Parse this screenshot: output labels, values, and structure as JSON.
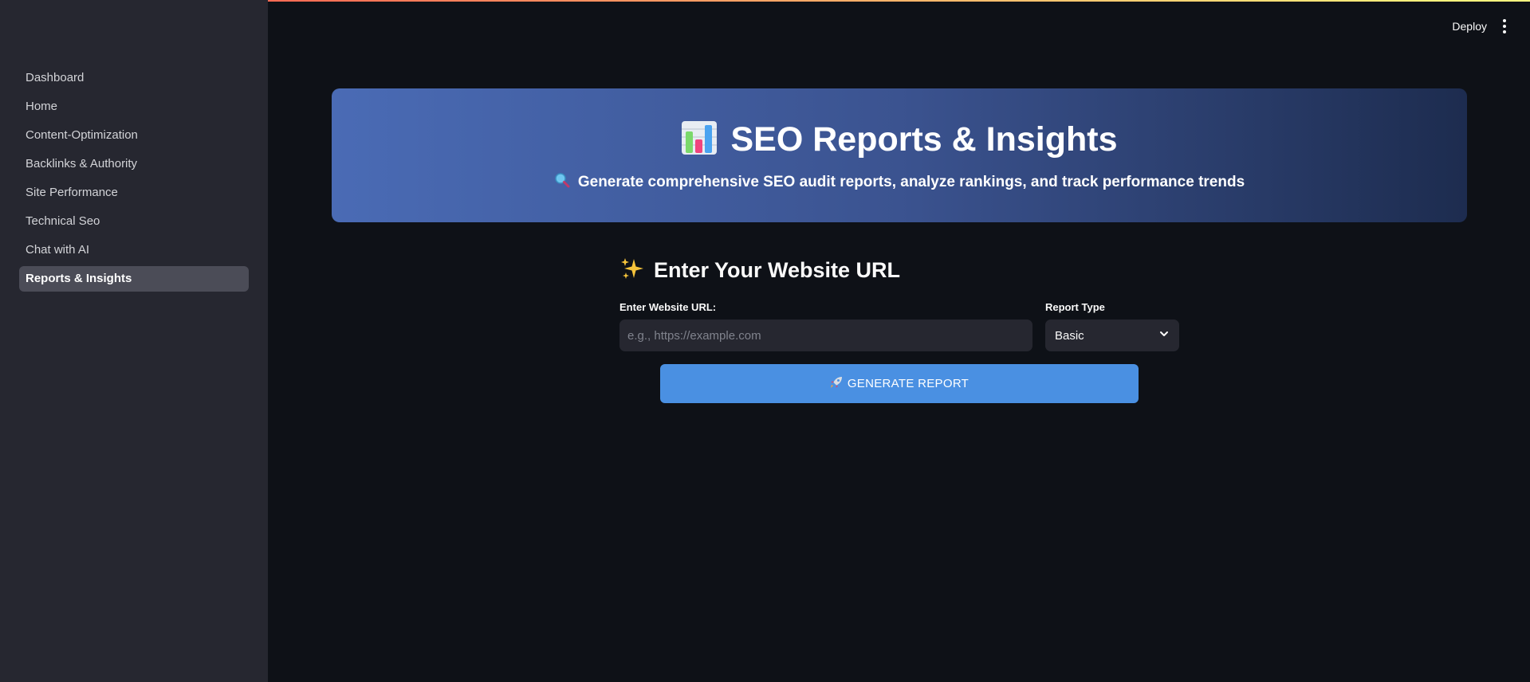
{
  "header": {
    "deploy_label": "Deploy"
  },
  "sidebar": {
    "items": [
      {
        "label": "Dashboard"
      },
      {
        "label": "Home"
      },
      {
        "label": "Content-Optimization"
      },
      {
        "label": "Backlinks & Authority"
      },
      {
        "label": "Site Performance"
      },
      {
        "label": "Technical Seo"
      },
      {
        "label": "Chat with AI"
      },
      {
        "label": "Reports & Insights",
        "active": true
      }
    ]
  },
  "banner": {
    "icon": "bar-chart-icon",
    "title": "SEO Reports & Insights",
    "subtitle_icon": "magnifier-icon",
    "subtitle": "Generate comprehensive SEO audit reports, analyze rankings, and track performance trends",
    "gradient_start": "#4a6bb5",
    "gradient_end": "#1d2c4f"
  },
  "form": {
    "section_icon": "sparkles-icon",
    "section_title": "Enter Your Website URL",
    "url_label": "Enter Website URL:",
    "url_placeholder": "e.g., https://example.com",
    "url_value": "",
    "report_type_label": "Report Type",
    "report_type_value": "Basic",
    "generate_icon": "rocket-icon",
    "generate_label": "GENERATE REPORT",
    "accent": "#4a90e2"
  }
}
